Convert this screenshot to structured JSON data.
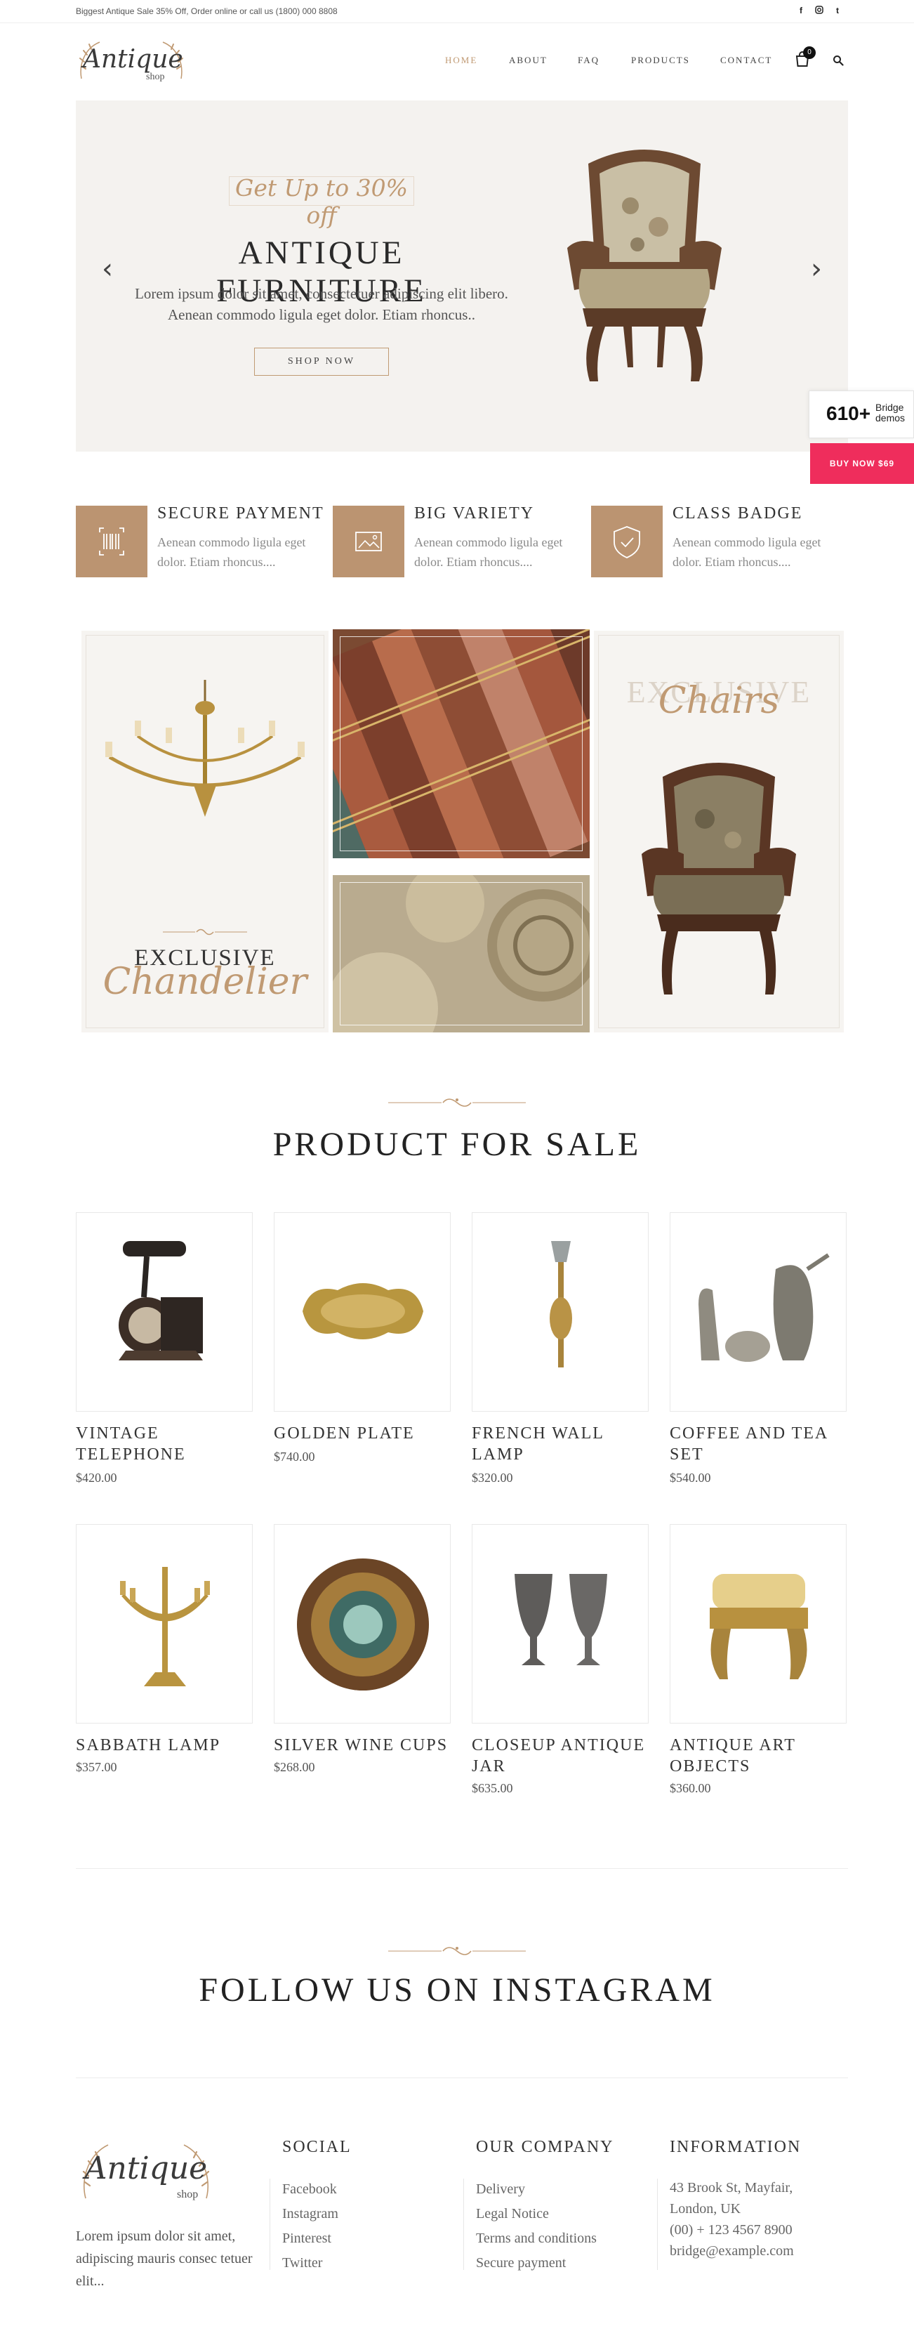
{
  "topbar": {
    "message": "Biggest Antique Sale 35% Off, Order online or call us (1800) 000 8808",
    "social": [
      "f",
      "◙",
      "t"
    ]
  },
  "header": {
    "logo": {
      "script": "Antique",
      "sub": "shop"
    },
    "nav": [
      "HOME",
      "ABOUT",
      "FAQ",
      "PRODUCTS",
      "CONTACT"
    ],
    "cart_count": "0",
    "icons": [
      "cart-icon",
      "search-icon"
    ]
  },
  "hero": {
    "script": "Get Up to 30% off",
    "title": "ANTIQUE FURNITURE",
    "text": "Lorem ipsum dolor sit amet, consectetuer adipiscing elit libero. Aenean commodo ligula eget dolor. Etiam rhoncus..",
    "button": "SHOP NOW",
    "prev": "‹",
    "next": "›"
  },
  "side": {
    "bridge_count": "610+",
    "bridge_label_1": "Bridge",
    "bridge_label_2": "demos",
    "buy_label": "BUY NOW $69"
  },
  "features": [
    {
      "title": "SECURE PAYMENT",
      "text": "Aenean commodo ligula eget dolor. Etiam rhoncus....",
      "icon": "barcode-icon"
    },
    {
      "title": "BIG VARIETY",
      "text": "Aenean commodo ligula eget dolor. Etiam rhoncus....",
      "icon": "image-icon"
    },
    {
      "title": "CLASS BADGE",
      "text": "Aenean commodo ligula eget dolor. Etiam rhoncus....",
      "icon": "shield-check-icon"
    }
  ],
  "gallery": {
    "left_title": "EXCLUSIVE",
    "left_script": "Chandelier",
    "right_title": "EXCLUSIVE",
    "right_script": "Chairs"
  },
  "products_section": {
    "title": "PRODUCT FOR SALE"
  },
  "products": [
    {
      "name": "VINTAGE TELEPHONE",
      "price": "$420.00"
    },
    {
      "name": "GOLDEN PLATE",
      "price": "$740.00"
    },
    {
      "name": "FRENCH WALL LAMP",
      "price": "$320.00"
    },
    {
      "name": "COFFEE AND TEA SET",
      "price": "$540.00"
    },
    {
      "name": "SABBATH LAMP",
      "price": "$357.00"
    },
    {
      "name": "SILVER WINE CUPS",
      "price": "$268.00"
    },
    {
      "name": "CLOSEUP ANTIQUE JAR",
      "price": "$635.00"
    },
    {
      "name": "ANTIQUE ART OBJECTS",
      "price": "$360.00"
    }
  ],
  "instagram": {
    "title": "FOLLOW US ON INSTAGRAM"
  },
  "footer": {
    "logo": {
      "script": "Antique",
      "sub": "shop"
    },
    "about": "Lorem ipsum dolor sit amet, adipiscing mauris consec tetuer elit...",
    "social": {
      "title": "SOCIAL",
      "items": [
        "Facebook",
        "Instagram",
        "Pinterest",
        "Twitter"
      ]
    },
    "company": {
      "title": "OUR COMPANY",
      "items": [
        "Delivery",
        "Legal Notice",
        "Terms and conditions",
        "Secure payment"
      ]
    },
    "info": {
      "title": "INFORMATION",
      "items": [
        "43 Brook St, Mayfair,",
        "London, UK",
        "(00) + 123 4567 8900",
        "bridge@example.com"
      ]
    }
  },
  "colors": {
    "accent": "#c09a73",
    "feature_box": "#bb9471",
    "buy_button": "#ef2d5c"
  }
}
